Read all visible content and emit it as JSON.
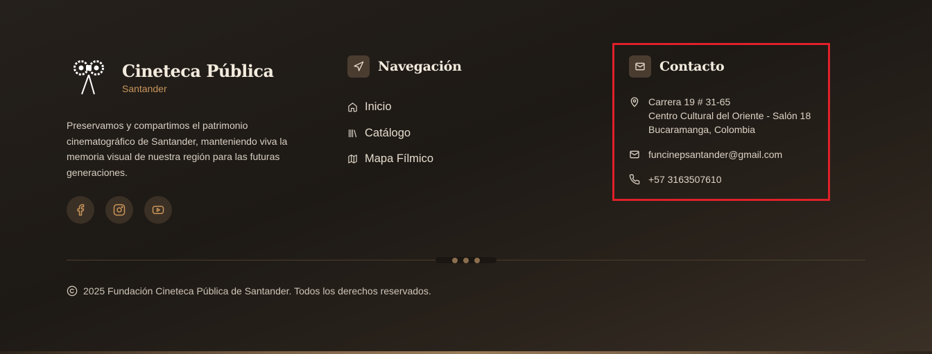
{
  "brand": {
    "title": "Cineteca Pública",
    "subtitle": "Santander",
    "description": "Preservamos y compartimos el patrimonio cinematográfico de Santander, manteniendo viva la memoria visual de nuestra región para las futuras generaciones.",
    "socials": [
      {
        "icon": "facebook-icon"
      },
      {
        "icon": "instagram-icon"
      },
      {
        "icon": "youtube-icon"
      }
    ]
  },
  "navigation": {
    "title": "Navegación",
    "icon": "navigation-arrow-icon",
    "items": [
      {
        "label": "Inicio",
        "icon": "home-icon"
      },
      {
        "label": "Catálogo",
        "icon": "library-icon"
      },
      {
        "label": "Mapa Fílmico",
        "icon": "map-icon"
      }
    ]
  },
  "contact": {
    "title": "Contacto",
    "icon": "mail-icon",
    "address_lines": [
      "Carrera 19 # 31-65",
      "Centro Cultural del Oriente - Salón 18",
      "Bucaramanga, Colombia"
    ],
    "email": "funcinepsantander@gmail.com",
    "phone": "+57 3163507610"
  },
  "copyright": "2025 Fundación Cineteca Pública de Santander. Todos los derechos reservados.",
  "colors": {
    "accent": "#c9955b",
    "highlight_border": "#e0202a",
    "background": "#1d1915"
  }
}
